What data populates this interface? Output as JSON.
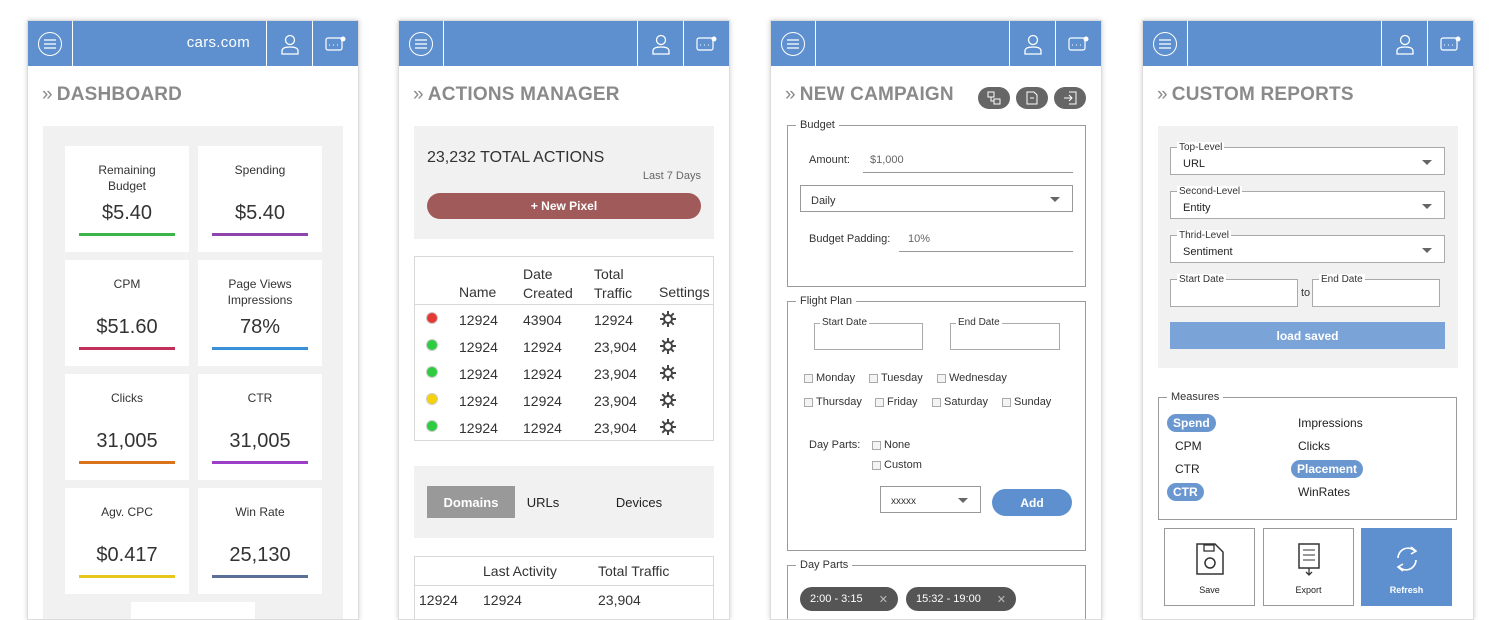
{
  "header": {
    "brand": "cars.com"
  },
  "dashboard": {
    "title": "DASHBOARD",
    "cards": [
      {
        "label": "Remaining Budget",
        "value": "$5.40",
        "color": "#3cb54a"
      },
      {
        "label": "Spending",
        "value": "$5.40",
        "color": "#8e44ad"
      },
      {
        "label": "CPM",
        "value": "$51.60",
        "color": "#c0305a"
      },
      {
        "label": "Page Views Impressions",
        "value": "78%",
        "color": "#3a8fd9"
      },
      {
        "label": "Clicks",
        "value": "31,005",
        "color": "#d9731c"
      },
      {
        "label": "CTR",
        "value": "31,005",
        "color": "#9b3fc9"
      },
      {
        "label": "Agv. CPC",
        "value": "$0.417",
        "color": "#e8c71c"
      },
      {
        "label": "Win Rate",
        "value": "25,130",
        "color": "#5a6e98"
      }
    ]
  },
  "actions": {
    "title": "ACTIONS MANAGER",
    "total": "23,232 TOTAL ACTIONS",
    "period": "Last 7 Days",
    "new_pixel": "+ New Pixel",
    "columns": [
      "Name",
      "Date Created",
      "Total Traffic",
      "Settings"
    ],
    "rows": [
      {
        "status": "#e53935",
        "name": "12924",
        "date": "43904",
        "traffic": "12924"
      },
      {
        "status": "#2ecc40",
        "name": "12924",
        "date": "12924",
        "traffic": "23,904"
      },
      {
        "status": "#2ecc40",
        "name": "12924",
        "date": "12924",
        "traffic": "23,904"
      },
      {
        "status": "#f5d10c",
        "name": "12924",
        "date": "12924",
        "traffic": "23,904"
      },
      {
        "status": "#2ecc40",
        "name": "12924",
        "date": "12924",
        "traffic": "23,904"
      }
    ],
    "tabs": [
      "Domains",
      "URLs",
      "Devices"
    ],
    "table2_columns": [
      "Last Activity",
      "Total Traffic"
    ],
    "table2_row": [
      "12924",
      "12924",
      "23,904"
    ]
  },
  "campaign": {
    "title": "NEW CAMPAIGN",
    "budget_legend": "Budget",
    "amount_label": "Amount:",
    "amount_value": "$1,000",
    "frequency": "Daily",
    "padding_label": "Budget Padding:",
    "padding_value": "10%",
    "flight_legend": "Flight Plan",
    "start_label": "Start Date",
    "end_label": "End Date",
    "days": [
      "Monday",
      "Tuesday",
      "Wednesday",
      "Thursday",
      "Friday",
      "Saturday",
      "Sunday"
    ],
    "dayparts_label": "Day Parts:",
    "dayparts_opts": [
      "None",
      "Custom"
    ],
    "select_value": "xxxxx",
    "add_label": "Add",
    "dayparts_legend": "Day Parts",
    "chips": [
      "2:00 - 3:15",
      "15:32 - 19:00"
    ]
  },
  "reports": {
    "title": "CUSTOM REPORTS",
    "filters": [
      {
        "label": "Top-Level",
        "value": "URL"
      },
      {
        "label": "Second-Level",
        "value": "Entity"
      },
      {
        "label": "Thrid-Level",
        "value": "Sentiment"
      }
    ],
    "start_label": "Start Date",
    "to_label": "to",
    "end_label": "End Date",
    "load_saved": "load saved",
    "measures_legend": "Measures",
    "measures": [
      {
        "label": "Spend",
        "on": true
      },
      {
        "label": "Impressions",
        "on": false
      },
      {
        "label": "CPM",
        "on": false
      },
      {
        "label": "Clicks",
        "on": false
      },
      {
        "label": "CTR",
        "on": false
      },
      {
        "label": "Placement",
        "on": true
      },
      {
        "label": "CTR",
        "on": true
      },
      {
        "label": "WinRates",
        "on": false
      }
    ],
    "save": "Save",
    "export": "Export",
    "refresh": "Refresh"
  }
}
